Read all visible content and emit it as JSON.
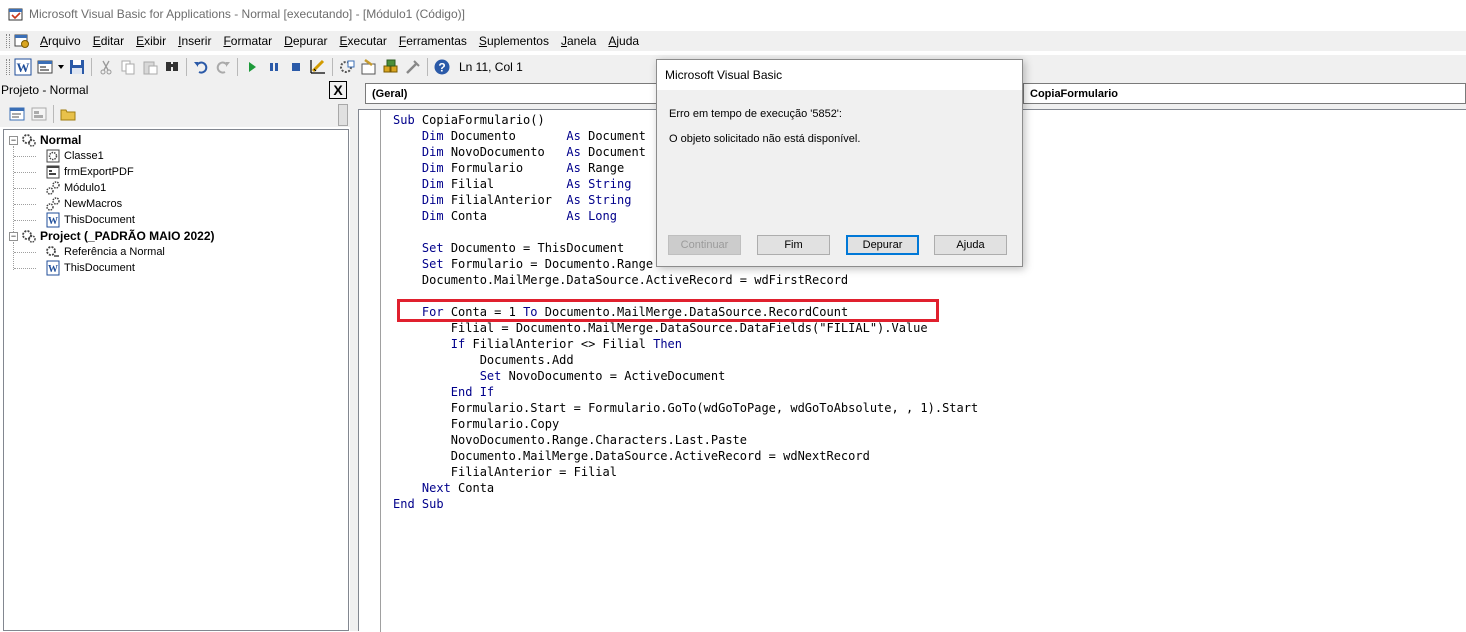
{
  "window": {
    "title": "Microsoft Visual Basic for Applications - Normal [executando] - [Módulo1 (Código)]"
  },
  "menu": {
    "items": [
      {
        "ul": "A",
        "rest": "rquivo"
      },
      {
        "ul": "E",
        "rest": "ditar"
      },
      {
        "ul": "E",
        "rest": "xibir"
      },
      {
        "ul": "I",
        "rest": "nserir"
      },
      {
        "ul": "F",
        "rest": "ormatar"
      },
      {
        "ul": "D",
        "rest": "epurar"
      },
      {
        "ul": "E",
        "rest": "xecutar"
      },
      {
        "ul": "F",
        "rest": "erramentas"
      },
      {
        "ul": "S",
        "rest": "uplementos"
      },
      {
        "ul": "J",
        "rest": "anela"
      },
      {
        "ul": "A",
        "rest": "juda"
      }
    ]
  },
  "toolbar": {
    "status": "Ln 11, Col 1",
    "icons": [
      "word-icon",
      "insert-userform-icon",
      "dropdown-arrow-icon",
      "save-icon",
      "cut-icon",
      "copy-icon",
      "paste-icon",
      "find-icon",
      "undo-icon",
      "redo-icon",
      "run-icon",
      "break-icon",
      "reset-icon",
      "design-mode-icon",
      "project-explorer-icon",
      "properties-icon",
      "object-browser-icon",
      "toolbox-icon",
      "help-icon"
    ]
  },
  "project": {
    "title": "Projeto - Normal",
    "close_label": "X",
    "tree": [
      {
        "label": "Normal",
        "bold": true,
        "level": 0,
        "icon": "vba-project-icon",
        "expander": "−"
      },
      {
        "label": "Classe1",
        "bold": false,
        "level": 1,
        "icon": "class-module-icon"
      },
      {
        "label": "frmExportPDF",
        "bold": false,
        "level": 1,
        "icon": "userform-icon"
      },
      {
        "label": "Módulo1",
        "bold": false,
        "level": 1,
        "icon": "module-icon"
      },
      {
        "label": "NewMacros",
        "bold": false,
        "level": 1,
        "icon": "module-icon"
      },
      {
        "label": "ThisDocument",
        "bold": false,
        "level": 1,
        "icon": "word-document-icon"
      },
      {
        "label": "Project (_PADRÃO MAIO 2022)",
        "bold": true,
        "level": 0,
        "icon": "vba-project-icon",
        "expander": "−"
      },
      {
        "label": "Referência a Normal",
        "bold": false,
        "level": 1,
        "icon": "reference-icon"
      },
      {
        "label": "ThisDocument",
        "bold": false,
        "level": 1,
        "icon": "word-document-icon"
      }
    ]
  },
  "code": {
    "object_combo": "(Geral)",
    "proc_combo": "CopiaFormulario",
    "lines": [
      [
        [
          "k",
          "Sub "
        ],
        [
          "t",
          "CopiaFormulario()"
        ]
      ],
      [
        [
          "t",
          "    "
        ],
        [
          "k",
          "Dim "
        ],
        [
          "t",
          "Documento       "
        ],
        [
          "k",
          "As "
        ],
        [
          "t",
          "Document"
        ]
      ],
      [
        [
          "t",
          "    "
        ],
        [
          "k",
          "Dim "
        ],
        [
          "t",
          "NovoDocumento   "
        ],
        [
          "k",
          "As "
        ],
        [
          "t",
          "Document"
        ]
      ],
      [
        [
          "t",
          "    "
        ],
        [
          "k",
          "Dim "
        ],
        [
          "t",
          "Formulario      "
        ],
        [
          "k",
          "As "
        ],
        [
          "t",
          "Range"
        ]
      ],
      [
        [
          "t",
          "    "
        ],
        [
          "k",
          "Dim "
        ],
        [
          "t",
          "Filial          "
        ],
        [
          "k",
          "As String"
        ]
      ],
      [
        [
          "t",
          "    "
        ],
        [
          "k",
          "Dim "
        ],
        [
          "t",
          "FilialAnterior  "
        ],
        [
          "k",
          "As String"
        ]
      ],
      [
        [
          "t",
          "    "
        ],
        [
          "k",
          "Dim "
        ],
        [
          "t",
          "Conta           "
        ],
        [
          "k",
          "As Long"
        ]
      ],
      [
        [
          "t",
          ""
        ]
      ],
      [
        [
          "t",
          "    "
        ],
        [
          "k",
          "Set "
        ],
        [
          "t",
          "Documento = ThisDocument"
        ]
      ],
      [
        [
          "t",
          "    "
        ],
        [
          "k",
          "Set "
        ],
        [
          "t",
          "Formulario = Documento.Range"
        ]
      ],
      [
        [
          "t",
          "    Documento.MailMerge.DataSource.ActiveRecord = wdFirstRecord"
        ]
      ],
      [
        [
          "t",
          ""
        ]
      ],
      [
        [
          "t",
          "    "
        ],
        [
          "k",
          "For "
        ],
        [
          "t",
          "Conta = 1 "
        ],
        [
          "k",
          "To "
        ],
        [
          "t",
          "Documento.MailMerge.DataSource.RecordCount"
        ]
      ],
      [
        [
          "t",
          "        Filial = Documento.MailMerge.DataSource.DataFields(\"FILIAL\").Value"
        ]
      ],
      [
        [
          "t",
          "        "
        ],
        [
          "k",
          "If "
        ],
        [
          "t",
          "FilialAnterior <> Filial "
        ],
        [
          "k",
          "Then"
        ]
      ],
      [
        [
          "t",
          "            Documents.Add"
        ]
      ],
      [
        [
          "t",
          "            "
        ],
        [
          "k",
          "Set "
        ],
        [
          "t",
          "NovoDocumento = ActiveDocument"
        ]
      ],
      [
        [
          "t",
          "        "
        ],
        [
          "k",
          "End If"
        ]
      ],
      [
        [
          "t",
          "        Formulario.Start = Formulario.GoTo(wdGoToPage, wdGoToAbsolute, , 1).Start"
        ]
      ],
      [
        [
          "t",
          "        Formulario.Copy"
        ]
      ],
      [
        [
          "t",
          "        NovoDocumento.Range.Characters.Last.Paste"
        ]
      ],
      [
        [
          "t",
          "        Documento.MailMerge.DataSource.ActiveRecord = wdNextRecord"
        ]
      ],
      [
        [
          "t",
          "        FilialAnterior = Filial"
        ]
      ],
      [
        [
          "t",
          "    "
        ],
        [
          "k",
          "Next "
        ],
        [
          "t",
          "Conta"
        ]
      ],
      [
        [
          "k",
          "End Sub"
        ]
      ]
    ]
  },
  "dialog": {
    "title": "Microsoft Visual Basic",
    "error": "Erro em tempo de execução '5852':",
    "message": "O objeto solicitado não está disponível.",
    "buttons": {
      "continue": "Continuar",
      "end": "Fim",
      "debug": "Depurar",
      "help": "Ajuda"
    }
  },
  "colors": {
    "keyword": "#00008b",
    "highlight_border": "#e0202e"
  }
}
